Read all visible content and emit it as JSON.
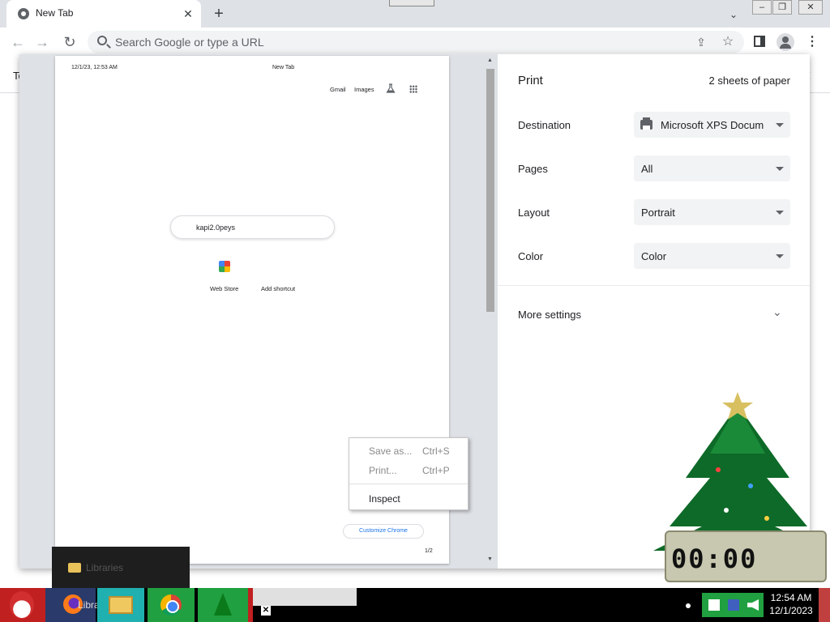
{
  "browser": {
    "tab_title": "New Tab",
    "omnibox_placeholder": "Search Google or type a URL"
  },
  "page_behind": {
    "text": "To"
  },
  "print_dialog": {
    "title": "Print",
    "sheet_count": "2 sheets of paper",
    "settings": [
      {
        "label": "Destination",
        "value": "Microsoft XPS Docum"
      },
      {
        "label": "Pages",
        "value": "All"
      },
      {
        "label": "Layout",
        "value": "Portrait"
      },
      {
        "label": "Color",
        "value": "Color"
      }
    ],
    "more_settings": "More settings"
  },
  "preview": {
    "date": "12/1/23, 12:53 AM",
    "title": "New Tab",
    "gmail": "Gmail",
    "images": "Images",
    "search_text": "kapi2.0peys",
    "shortcuts": [
      "Web Store",
      "Add shortcut"
    ],
    "customize": "Customize Chrome",
    "page_number": "1/2"
  },
  "context_menu": {
    "items": [
      {
        "label": "Save as...",
        "shortcut": "Ctrl+S"
      },
      {
        "label": "Print...",
        "shortcut": "Ctrl+P"
      },
      {
        "label": "Inspect",
        "shortcut": ""
      }
    ]
  },
  "explorer_popup": {
    "label": "Libraries"
  },
  "taskbar": {
    "libraries_text": "Libra",
    "clock_time": "12:54 AM",
    "clock_date": "12/1/2023"
  },
  "decoration": {
    "clock_digits": "00:00"
  },
  "colors": {
    "accent": "#1a73e8",
    "taskbar": "#000000",
    "dialog_bg": "#ffffff"
  }
}
